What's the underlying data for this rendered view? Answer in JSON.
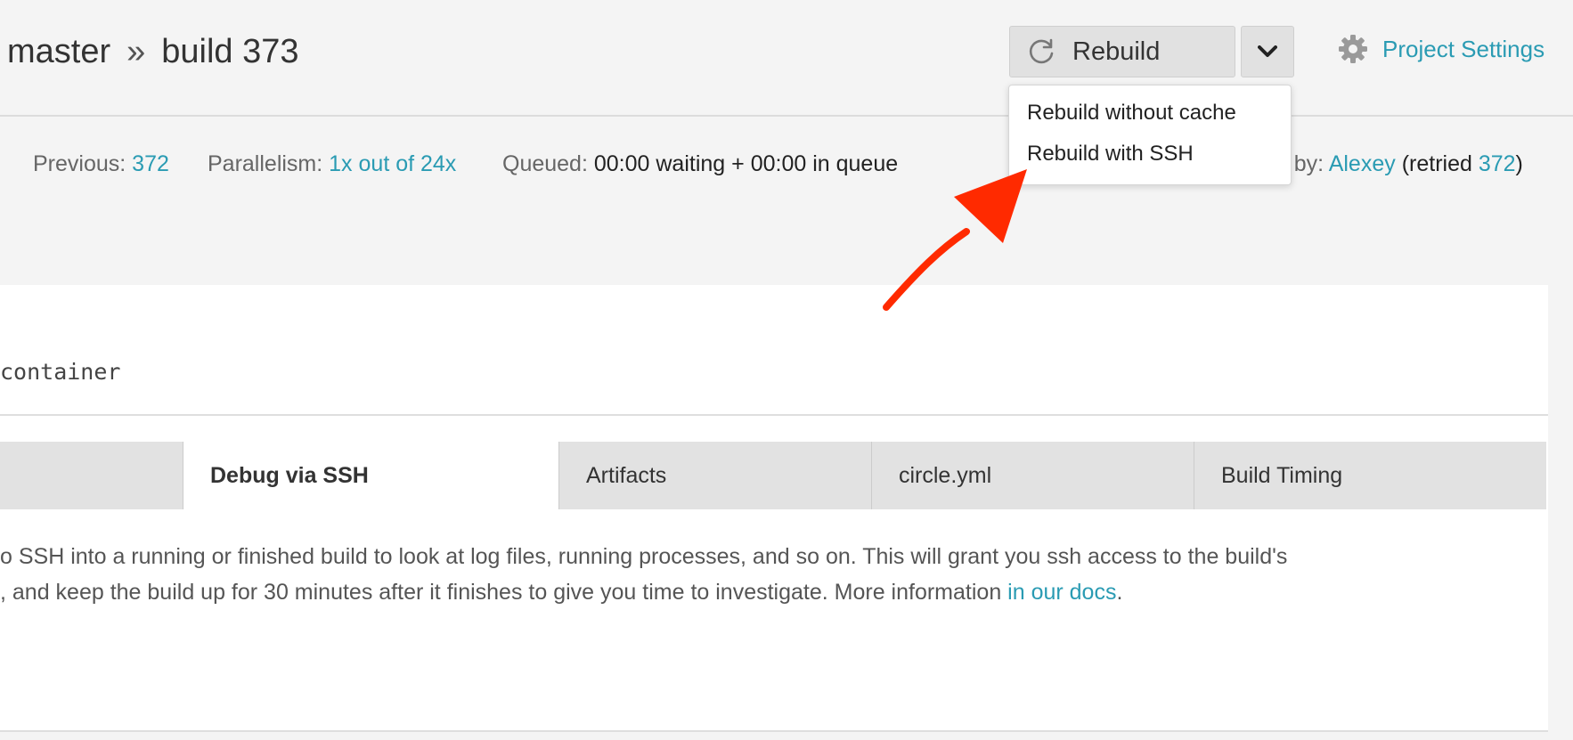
{
  "header": {
    "branch": "master",
    "separator": "»",
    "build": "build 373",
    "rebuild_label": "Rebuild",
    "settings_label": "Project Settings"
  },
  "dropdown": {
    "items": [
      {
        "label": "Rebuild without cache"
      },
      {
        "label": "Rebuild with SSH"
      }
    ]
  },
  "info": {
    "previous_label": "Previous:",
    "previous_value": "372",
    "parallelism_label": "Parallelism:",
    "parallelism_value": "1x out of 24x",
    "queued_label": "Queued:",
    "queued_value": "00:00 waiting + 00:00 in queue",
    "triggered_label_partial": "ed by:",
    "triggered_user": "Alexey",
    "retried_prefix": "(retried",
    "retried_value": "372",
    "retried_suffix": ")"
  },
  "panel": {
    "container_text": "container"
  },
  "tabs": [
    {
      "label": ""
    },
    {
      "label": "Debug via SSH"
    },
    {
      "label": "Artifacts"
    },
    {
      "label": "circle.yml"
    },
    {
      "label": "Build Timing"
    }
  ],
  "description": {
    "line1": "o SSH into a running or finished build to look at log files, running processes, and so on. This will grant you ssh access to the build's",
    "line2_prefix": ", and keep the build up for 30 minutes after it finishes to give you time to investigate. More information",
    "line2_link": "in our docs",
    "line2_suffix": "."
  },
  "colors": {
    "link": "#2a9bb3",
    "annotation_arrow": "#ff2a00",
    "background": "#f4f4f4"
  }
}
